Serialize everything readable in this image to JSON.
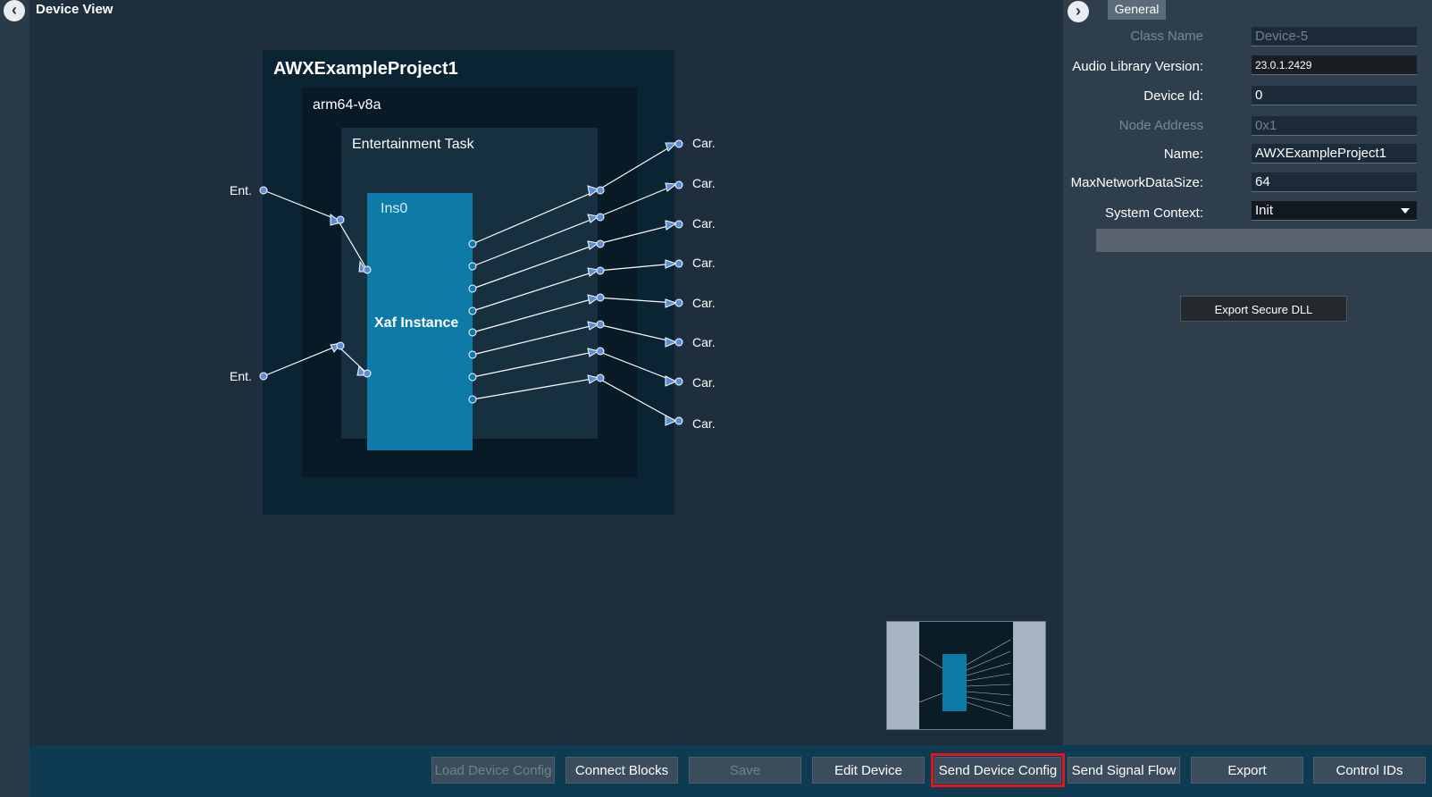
{
  "canvas": {
    "title": "Device View",
    "project": "AWXExampleProject1",
    "core": "arm64-v8a",
    "task": "Entertainment Task",
    "instance_name": "Ins0",
    "instance_type": "Xaf Instance",
    "input_label": "Ent.",
    "output_label": "Car."
  },
  "toolbar": {
    "load_device_config": "Load Device Config",
    "connect_blocks": "Connect Blocks",
    "save": "Save",
    "edit_device": "Edit Device",
    "send_device_config": "Send Device Config",
    "send_signal_flow": "Send Signal Flow",
    "export": "Export",
    "control_ids": "Control IDs"
  },
  "properties": {
    "tab": "General",
    "class_name_label": "Class Name",
    "class_name_value": "Device-5",
    "audio_lib_label": "Audio Library Version:",
    "audio_lib_value": "23.0.1.2429",
    "device_id_label": "Device Id:",
    "device_id_value": "0",
    "node_address_label": "Node Address",
    "node_address_value": "0x1",
    "name_label": "Name:",
    "name_value": "AWXExampleProject1",
    "max_net_label": "MaxNetworkDataSize:",
    "max_net_value": "64",
    "system_context_label": "System Context:",
    "system_context_value": "Init",
    "export_secure_dll": "Export Secure DLL"
  },
  "colors": {
    "highlight": "#e3141b",
    "instance_fill": "#0d7aa8"
  }
}
